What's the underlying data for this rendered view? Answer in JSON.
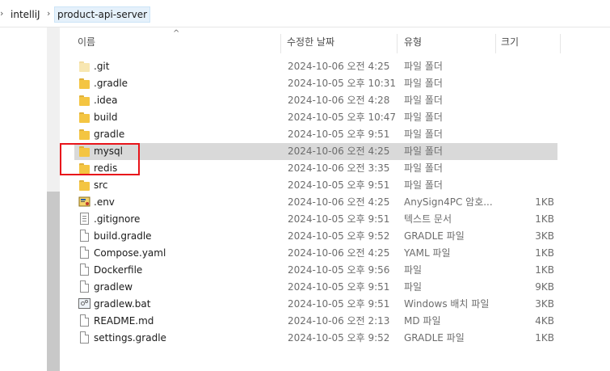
{
  "breadcrumb": {
    "items": [
      {
        "label": "intelliJ"
      },
      {
        "label": "product-api-server"
      }
    ]
  },
  "columns": {
    "name": "이름",
    "modified": "수정한 날짜",
    "type": "유형",
    "size": "크기"
  },
  "files": [
    {
      "name": ".git",
      "modified": "2024-10-06 오전 4:25",
      "type": "파일 폴더",
      "size": "",
      "icon": "folder-icon-hidden"
    },
    {
      "name": ".gradle",
      "modified": "2024-10-05 오후 10:31",
      "type": "파일 폴더",
      "size": "",
      "icon": "folder-icon"
    },
    {
      "name": ".idea",
      "modified": "2024-10-06 오전 4:28",
      "type": "파일 폴더",
      "size": "",
      "icon": "folder-icon"
    },
    {
      "name": "build",
      "modified": "2024-10-05 오후 10:47",
      "type": "파일 폴더",
      "size": "",
      "icon": "folder-icon"
    },
    {
      "name": "gradle",
      "modified": "2024-10-05 오후 9:51",
      "type": "파일 폴더",
      "size": "",
      "icon": "folder-icon"
    },
    {
      "name": "mysql",
      "modified": "2024-10-06 오전 4:25",
      "type": "파일 폴더",
      "size": "",
      "icon": "folder-icon"
    },
    {
      "name": "redis",
      "modified": "2024-10-06 오전 3:35",
      "type": "파일 폴더",
      "size": "",
      "icon": "folder-icon"
    },
    {
      "name": "src",
      "modified": "2024-10-05 오후 9:51",
      "type": "파일 폴더",
      "size": "",
      "icon": "folder-icon"
    },
    {
      "name": ".env",
      "modified": "2024-10-06 오전 4:25",
      "type": "AnySign4PC 암호...",
      "size": "1KB",
      "icon": "certificate-file-icon"
    },
    {
      "name": ".gitignore",
      "modified": "2024-10-05 오후 9:51",
      "type": "텍스트 문서",
      "size": "1KB",
      "icon": "text-file-icon"
    },
    {
      "name": "build.gradle",
      "modified": "2024-10-05 오후 9:52",
      "type": "GRADLE 파일",
      "size": "3KB",
      "icon": "file-icon"
    },
    {
      "name": "Compose.yaml",
      "modified": "2024-10-06 오전 4:25",
      "type": "YAML 파일",
      "size": "1KB",
      "icon": "file-icon"
    },
    {
      "name": "Dockerfile",
      "modified": "2024-10-05 오후 9:56",
      "type": "파일",
      "size": "1KB",
      "icon": "file-icon"
    },
    {
      "name": "gradlew",
      "modified": "2024-10-05 오후 9:51",
      "type": "파일",
      "size": "9KB",
      "icon": "file-icon"
    },
    {
      "name": "gradlew.bat",
      "modified": "2024-10-05 오후 9:51",
      "type": "Windows 배치 파일",
      "size": "3KB",
      "icon": "batch-file-icon"
    },
    {
      "name": "README.md",
      "modified": "2024-10-06 오전 2:13",
      "type": "MD 파일",
      "size": "4KB",
      "icon": "file-icon"
    },
    {
      "name": "settings.gradle",
      "modified": "2024-10-05 오후 9:52",
      "type": "GRADLE 파일",
      "size": "1KB",
      "icon": "file-icon"
    }
  ],
  "selected_row": "mysql",
  "colors": {
    "selection": "#d9d9d9",
    "highlight_box": "#e8151b",
    "folder": "#f4c542"
  }
}
